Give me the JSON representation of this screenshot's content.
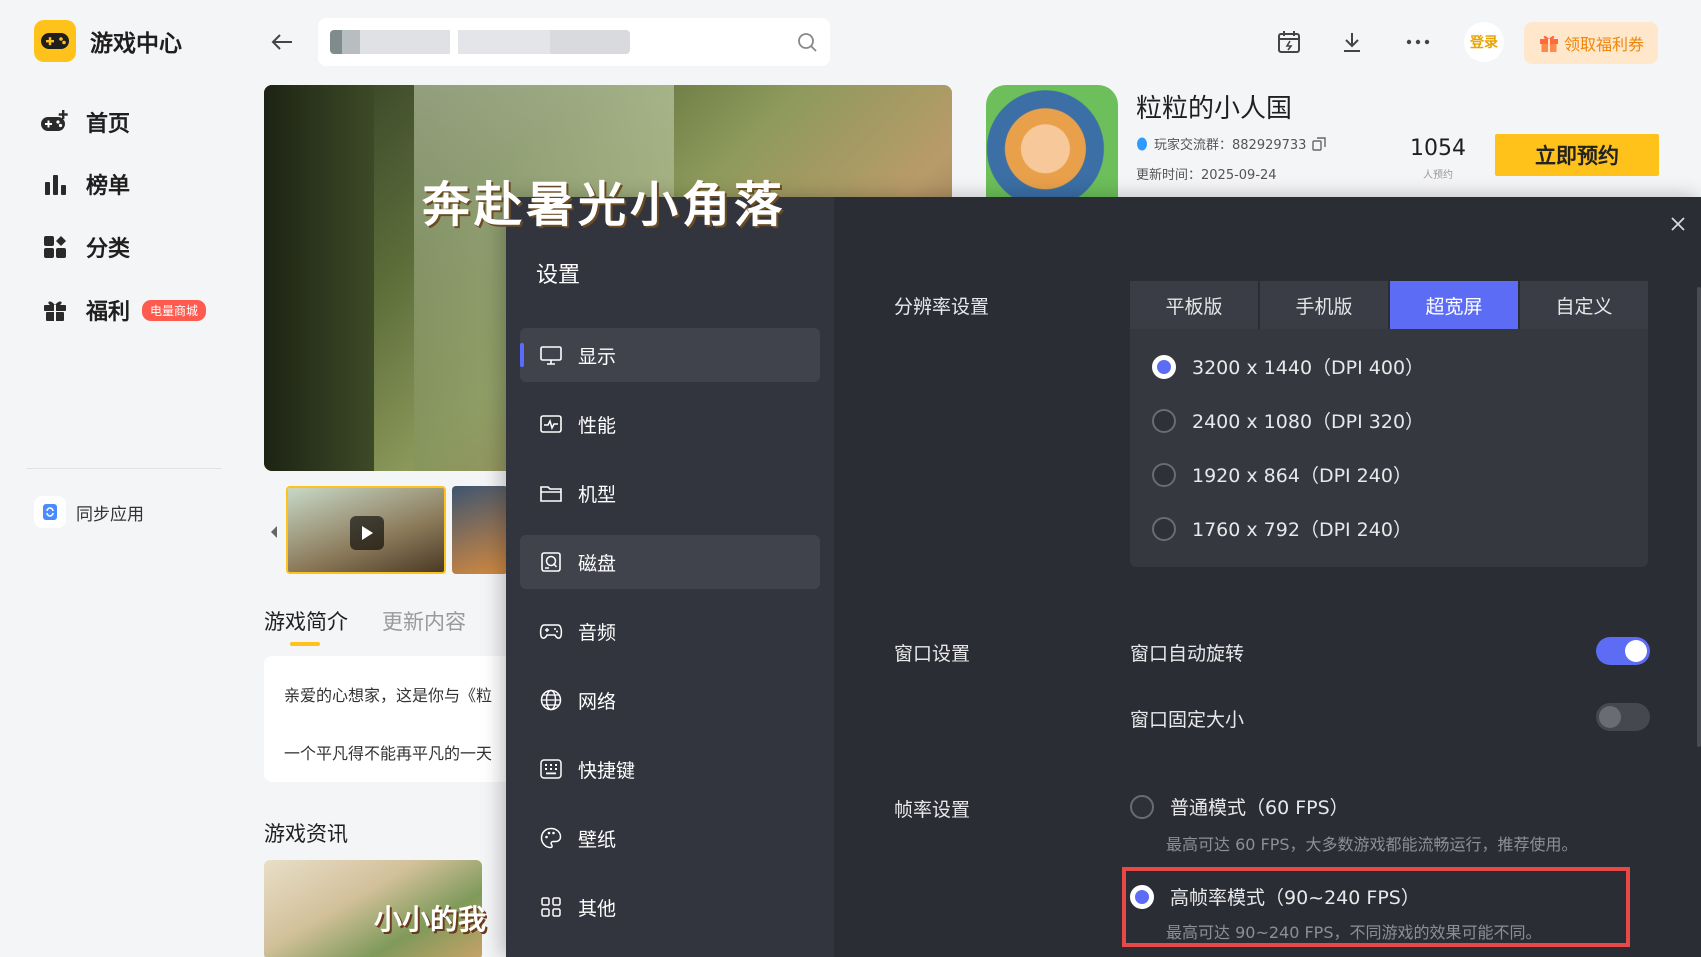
{
  "app": {
    "title": "游戏中心"
  },
  "sidebar": {
    "items": [
      {
        "label": "首页",
        "icon": "gamepad-plus-icon"
      },
      {
        "label": "榜单",
        "icon": "bar-chart-icon"
      },
      {
        "label": "分类",
        "icon": "category-icon"
      },
      {
        "label": "福利",
        "icon": "gift-icon",
        "badge": "电量商城"
      }
    ],
    "sync": {
      "label": "同步应用"
    }
  },
  "topbar": {
    "search": {
      "value": "",
      "placeholder": ""
    },
    "login_label": "登录",
    "welfare_label": "领取福利券"
  },
  "banner": {
    "title": "奔赴暑光小角落"
  },
  "content": {
    "tabs": [
      {
        "label": "游戏简介",
        "active": true
      },
      {
        "label": "更新内容",
        "active": false
      }
    ],
    "intro": {
      "line1": "亲爱的心想家，这是你与《粒",
      "line2": "一个平凡得不能再平凡的一天"
    },
    "news_title": "游戏资讯",
    "news_image_text": "小小的我"
  },
  "game": {
    "name": "粒粒的小人国",
    "qq_group": "玩家交流群：882929733",
    "update_time": "更新时间：2025-09-24",
    "booking_count": "1054",
    "booking_label": "人预约",
    "reserve_label": "立即预约"
  },
  "settings": {
    "title": "设置",
    "menu": [
      {
        "label": "显示",
        "icon": "monitor-icon",
        "active": true,
        "highlight": true
      },
      {
        "label": "性能",
        "icon": "performance-icon",
        "active": false,
        "highlight": false
      },
      {
        "label": "机型",
        "icon": "folder-icon",
        "active": false,
        "highlight": false
      },
      {
        "label": "磁盘",
        "icon": "disk-icon",
        "active": false,
        "highlight": true
      },
      {
        "label": "音频",
        "icon": "gamepad-icon",
        "active": false,
        "highlight": false
      },
      {
        "label": "网络",
        "icon": "globe-icon",
        "active": false,
        "highlight": false
      },
      {
        "label": "快捷键",
        "icon": "keyboard-icon",
        "active": false,
        "highlight": false
      },
      {
        "label": "壁纸",
        "icon": "palette-icon",
        "active": false,
        "highlight": false
      },
      {
        "label": "其他",
        "icon": "grid-icon",
        "active": false,
        "highlight": false
      }
    ],
    "resolution": {
      "label": "分辨率设置",
      "tabs": [
        {
          "label": "平板版",
          "selected": false
        },
        {
          "label": "手机版",
          "selected": false
        },
        {
          "label": "超宽屏",
          "selected": true
        },
        {
          "label": "自定义",
          "selected": false
        }
      ],
      "options": [
        {
          "label": "3200 x 1440（DPI 400）",
          "selected": true
        },
        {
          "label": "2400 x 1080（DPI 320）",
          "selected": false
        },
        {
          "label": "1920 x 864（DPI 240）",
          "selected": false
        },
        {
          "label": "1760 x 792（DPI 240）",
          "selected": false
        }
      ]
    },
    "window": {
      "label": "窗口设置",
      "auto_rotate": {
        "label": "窗口自动旋转",
        "on": true
      },
      "fixed_size": {
        "label": "窗口固定大小",
        "on": false
      }
    },
    "fps": {
      "label": "帧率设置",
      "normal": {
        "label": "普通模式（60 FPS）",
        "desc": "最高可达 60 FPS，大多数游戏都能流畅运行，推荐使用。",
        "selected": false
      },
      "high": {
        "label": "高帧率模式（90~240 FPS）",
        "desc": "最高可达 90~240 FPS，不同游戏的效果可能不同。",
        "selected": true
      }
    }
  },
  "colors": {
    "brand_yellow": "#ffc21a",
    "accent_blue": "#5c6cf4",
    "modal_bg": "#2b2d35",
    "highlight_red": "#e84848"
  }
}
